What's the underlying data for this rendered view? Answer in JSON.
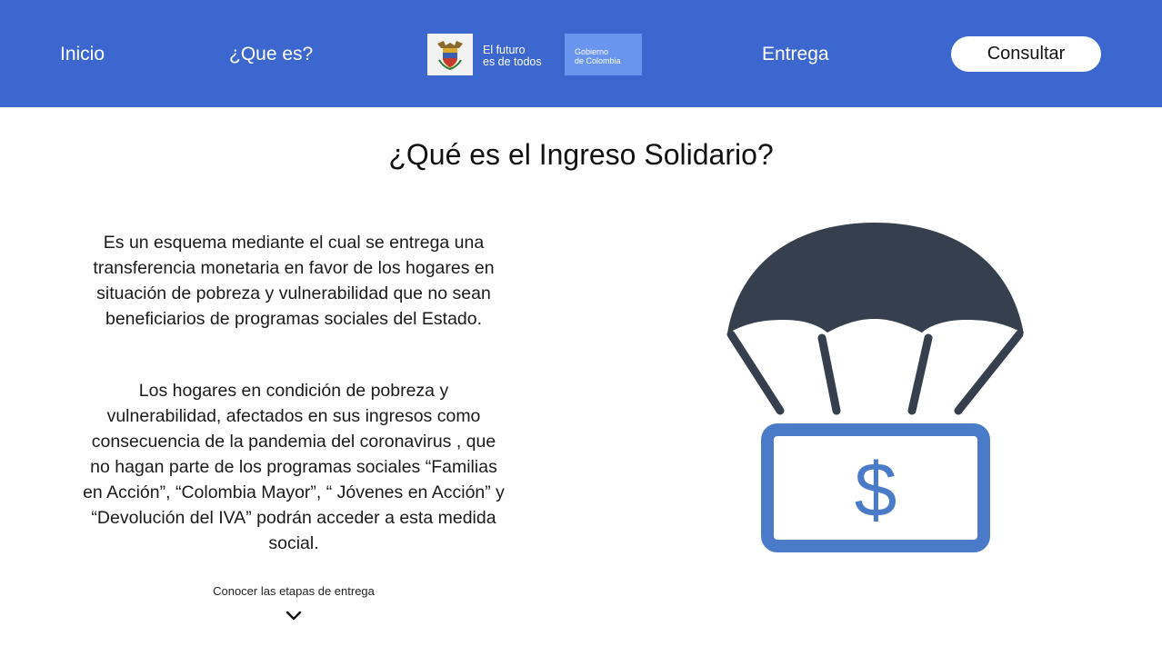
{
  "nav": {
    "inicio": "Inicio",
    "que_es": "¿Que es?",
    "entrega": "Entrega",
    "consultar": "Consultar"
  },
  "logo": {
    "tagline_line1": "El futuro",
    "tagline_line2": "es de todos",
    "gov_line1": "Gobierno",
    "gov_line2": "de Colombia"
  },
  "main": {
    "title": "¿Qué es el Ingreso Solidario?",
    "paragraph1": "Es un esquema mediante el cual se entrega una transferencia monetaria en favor de los hogares en situación de pobreza y vulnerabilidad que no sean beneficiarios de programas sociales del Estado.",
    "paragraph2": "Los hogares en condición de pobreza y vulnerabilidad, afectados en sus ingresos como consecuencia de la pandemia del coronavirus , que no hagan parte de los programas sociales “Familias en Acción”, “Colombia Mayor”, “ Jóvenes en Acción” y “Devolución del IVA” podrán acceder a esta medida social.",
    "stages_link": "Conocer las etapas de entrega"
  },
  "illustration": {
    "currency_symbol": "$",
    "icon": "parachute-money-icon"
  },
  "colors": {
    "navbar": "#3b67cf",
    "parachute": "#363f4e",
    "bill": "#4a7bc8"
  }
}
